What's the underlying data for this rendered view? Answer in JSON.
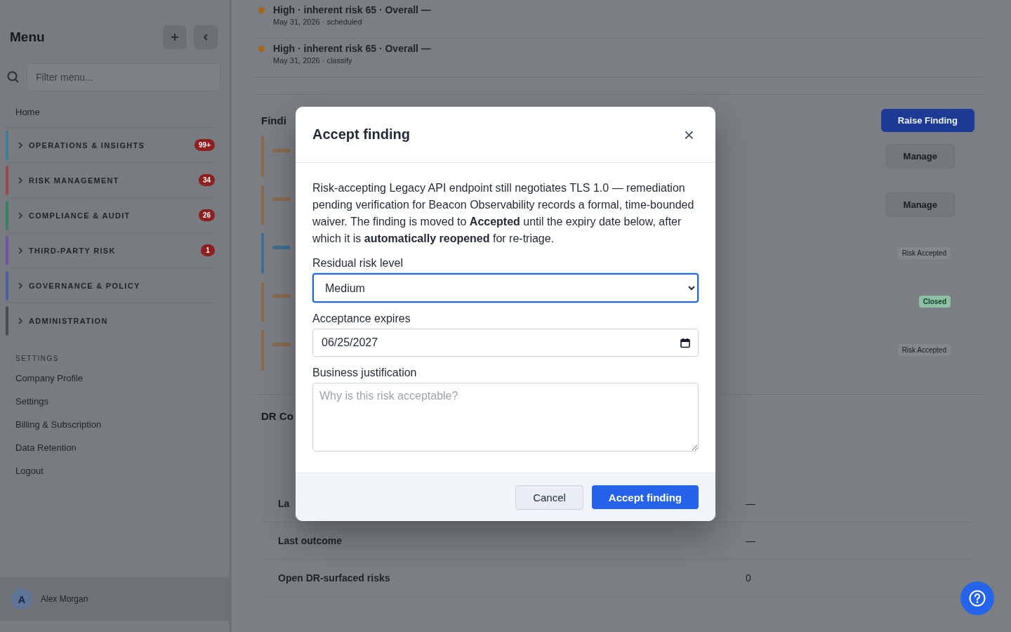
{
  "sidebar": {
    "title": "Menu",
    "filter_placeholder": "Filter menu...",
    "home": "Home",
    "sections": [
      {
        "label": "OPERATIONS & INSIGHTS",
        "badge": "99+",
        "color": "#3f7d99"
      },
      {
        "label": "RISK MANAGEMENT",
        "badge": "34",
        "color": "#9a4848"
      },
      {
        "label": "COMPLIANCE & AUDIT",
        "badge": "26",
        "color": "#3c7e62"
      },
      {
        "label": "THIRD-PARTY RISK",
        "badge": "1",
        "color": "#6e55a8"
      },
      {
        "label": "GOVERNANCE & POLICY",
        "color": "#4d5f9e"
      },
      {
        "label": "ADMINISTRATION",
        "color": "#4a4e55"
      }
    ],
    "settings_heading": "SETTINGS",
    "settings_items": [
      "Company Profile",
      "Settings",
      "Billing & Subscription",
      "Data Retention",
      "Logout"
    ],
    "user": {
      "initial": "A",
      "name": "Alex Morgan"
    }
  },
  "timeline": [
    {
      "title": "High · inherent risk 65 · Overall —",
      "meta": "May 31, 2026 · scheduled"
    },
    {
      "title": "High · inherent risk 65 · Overall —",
      "meta": "May 31, 2026 · classify"
    }
  ],
  "findings": {
    "heading": "Findi",
    "raise_button": "Raise Finding",
    "rows": [
      {
        "color": "#8c6a4e",
        "kind": "button",
        "action": "Manage"
      },
      {
        "color": "#8c6a4e",
        "kind": "button",
        "action": "Manage"
      },
      {
        "color": "#3f6f92",
        "kind": "tag",
        "action": "Risk Accepted"
      },
      {
        "color": "#8c6a4e",
        "kind": "tag_green",
        "action": "Closed"
      },
      {
        "color": "#8c6a4e",
        "kind": "tag",
        "action": "Risk Accepted"
      }
    ]
  },
  "dr": {
    "heading": "DR Co",
    "rows": [
      {
        "label": "La",
        "value": "—"
      },
      {
        "label": "Last outcome",
        "value": "—"
      },
      {
        "label": "Open DR-surfaced risks",
        "value": "0"
      }
    ]
  },
  "modal": {
    "title": "Accept finding",
    "close": "×",
    "text": "Risk-accepting Legacy API endpoint still negotiates TLS 1.0 — remediation pending verification for Beacon Observability records a formal, time-bounded waiver. The finding is moved to **Accepted** until the expiry date below, after which it is **automatically reopened** for re-triage.",
    "fields": [
      {
        "kind": "select",
        "label": "Residual risk level",
        "value": "Medium",
        "focused": true
      },
      {
        "kind": "date",
        "label": "Acceptance expires",
        "value": "06/25/2027",
        "focused": false
      },
      {
        "kind": "textarea",
        "label": "Business justification",
        "placeholder": "Why is this risk acceptable?",
        "focused": false
      }
    ],
    "cancel": "Cancel",
    "confirm": "Accept finding"
  }
}
